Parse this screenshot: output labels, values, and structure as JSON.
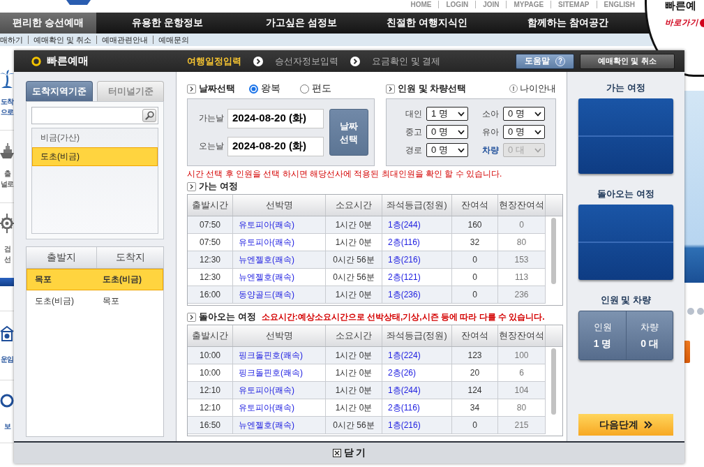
{
  "site": {
    "top_links": [
      "HOME",
      "LOGIN",
      "JOIN",
      "MYPAGE",
      "SITEMAP",
      "ENGLISH"
    ],
    "main_nav": [
      {
        "label": "편리한 승선예매",
        "selected": true
      },
      {
        "label": "유용한 운항정보",
        "selected": false
      },
      {
        "label": "가고싶은 섬정보",
        "selected": false
      },
      {
        "label": "친절한 여행지식인",
        "selected": false
      },
      {
        "label": "함께하는 참여공간",
        "selected": false
      }
    ],
    "sub_nav": [
      "매하기",
      "예매확인 및 취소",
      "예매관련안내",
      "예매문의"
    ],
    "banner": {
      "title": "빠른예",
      "link": "바로가기"
    },
    "side_menu": [
      {
        "kind": "island",
        "lines": [
          "도착",
          "으로"
        ]
      },
      {
        "kind": "ship",
        "lines": [
          "출",
          "널로"
        ]
      },
      {
        "kind": "helm",
        "lines": [
          "검",
          "선"
        ]
      },
      {
        "kind": "fare",
        "lines": [
          "운임"
        ]
      },
      {
        "kind": "info",
        "lines": [
          "보"
        ]
      }
    ]
  },
  "dialog": {
    "title": "빠른예매",
    "steps": [
      {
        "label": "여행일정입력",
        "selected": true
      },
      {
        "label": "승선자정보입력",
        "selected": false
      },
      {
        "label": "요금확인 및 결제",
        "selected": false
      }
    ],
    "help_button": {
      "label": "도움말",
      "icon": "?"
    },
    "lookup_button": "예매확인 및 취소",
    "region_tabs": [
      {
        "label": "도착지역기준",
        "selected": true
      },
      {
        "label": "터미널기준",
        "selected": false
      }
    ],
    "areas": [
      {
        "label": "비금(가산)",
        "selected": false
      },
      {
        "label": "도초(비금)",
        "selected": true
      }
    ],
    "routes": {
      "columns": [
        "출발지",
        "도착지"
      ],
      "rows": [
        {
          "from": "목포",
          "to": "도초(비금)",
          "selected": true
        },
        {
          "from": "도초(비금)",
          "to": "목포",
          "selected": false
        }
      ]
    },
    "date_section": {
      "title": "날짜선택",
      "trip_types": [
        {
          "label": "왕복",
          "selected": true
        },
        {
          "label": "편도",
          "selected": false
        }
      ],
      "dates": [
        {
          "label": "가는날",
          "value": "2024-08-20 (화)"
        },
        {
          "label": "오는날",
          "value": "2024-08-20 (화)"
        }
      ],
      "button": "날짜 선택"
    },
    "party_section": {
      "title": "인원 및 차량선택",
      "info_icon": "!",
      "info_link": "나이안내",
      "fields": [
        {
          "kind": "person",
          "label": "대인",
          "value": "1 명",
          "disabled": false
        },
        {
          "kind": "person",
          "label": "소아",
          "value": "0 명",
          "disabled": false
        },
        {
          "kind": "person",
          "label": "중고",
          "value": "0 명",
          "disabled": false
        },
        {
          "kind": "person",
          "label": "유아",
          "value": "0 명",
          "disabled": false
        },
        {
          "kind": "person",
          "label": "경로",
          "value": "0 명",
          "disabled": false
        },
        {
          "kind": "vehicle",
          "label": "차량",
          "value": "0 대",
          "disabled": true
        }
      ]
    },
    "notice": "시간 선택 후 인원을 선택 하시면 해당선사에 적용된 최대인원을 확인 할 수 있습니다.",
    "trips": [
      {
        "title": "가는 여정",
        "columns": [
          {
            "label": "출발시간",
            "kind": "plain"
          },
          {
            "label": "선박명",
            "kind": "link"
          },
          {
            "label": "소요시간",
            "kind": "plain"
          },
          {
            "label": "좌석등급(정원)",
            "kind": "link"
          },
          {
            "label": "잔여석",
            "kind": "plain"
          },
          {
            "label": "현장잔여석",
            "kind": "muted"
          }
        ],
        "rows": [
          {
            "cells": [
              "07:50",
              "유토피아(쾌속)",
              "1시간 0분",
              "1층(244)",
              "160",
              "0"
            ],
            "selected": false
          },
          {
            "cells": [
              "07:50",
              "유토피아(쾌속)",
              "1시간 0분",
              "2층(116)",
              "32",
              "80"
            ],
            "selected": false
          },
          {
            "cells": [
              "12:30",
              "뉴엔젤호(쾌속)",
              "0시간 56분",
              "1층(216)",
              "0",
              "153"
            ],
            "selected": false
          },
          {
            "cells": [
              "12:30",
              "뉴엔젤호(쾌속)",
              "0시간 56분",
              "2층(121)",
              "0",
              "113"
            ],
            "selected": false
          },
          {
            "cells": [
              "16:00",
              "동양골드(쾌속)",
              "1시간 0분",
              "1층(236)",
              "0",
              "236"
            ],
            "selected": false
          }
        ]
      },
      {
        "title": "돌아오는 여정",
        "note": "소요시간:예상소요시간으로 선박상태,기상,시즌 등에 따라 다를 수 있습니다.",
        "columns": [
          {
            "label": "출발시간",
            "kind": "plain"
          },
          {
            "label": "선박명",
            "kind": "link"
          },
          {
            "label": "소요시간",
            "kind": "plain"
          },
          {
            "label": "좌석등급(정원)",
            "kind": "link"
          },
          {
            "label": "잔여석",
            "kind": "plain"
          },
          {
            "label": "현장잔여석",
            "kind": "muted"
          }
        ],
        "rows": [
          {
            "cells": [
              "10:00",
              "핑크돌핀호(쾌속)",
              "1시간 0분",
              "1층(224)",
              "123",
              "100"
            ],
            "selected": false
          },
          {
            "cells": [
              "10:00",
              "핑크돌핀호(쾌속)",
              "1시간 0분",
              "2층(26)",
              "20",
              "6"
            ],
            "selected": false
          },
          {
            "cells": [
              "12:10",
              "유토피아(쾌속)",
              "1시간 0분",
              "1층(244)",
              "124",
              "104"
            ],
            "selected": false
          },
          {
            "cells": [
              "12:10",
              "유토피아(쾌속)",
              "1시간 0분",
              "2층(116)",
              "34",
              "80"
            ],
            "selected": false
          },
          {
            "cells": [
              "16:50",
              "뉴엔젤호(쾌속)",
              "0시간 56분",
              "1층(216)",
              "0",
              "215"
            ],
            "selected": false
          }
        ]
      }
    ],
    "summary": {
      "sections": [
        {
          "kind": "trip",
          "title": "가는 여정"
        },
        {
          "kind": "trip",
          "title": "돌아오는 여정"
        },
        {
          "kind": "party",
          "title": "인원 및 차량",
          "items": [
            {
              "label": "인원",
              "value": "1 명"
            },
            {
              "label": "차량",
              "value": "0 대"
            }
          ]
        }
      ],
      "next_button": "다음단계"
    },
    "close_button": "닫 기"
  }
}
